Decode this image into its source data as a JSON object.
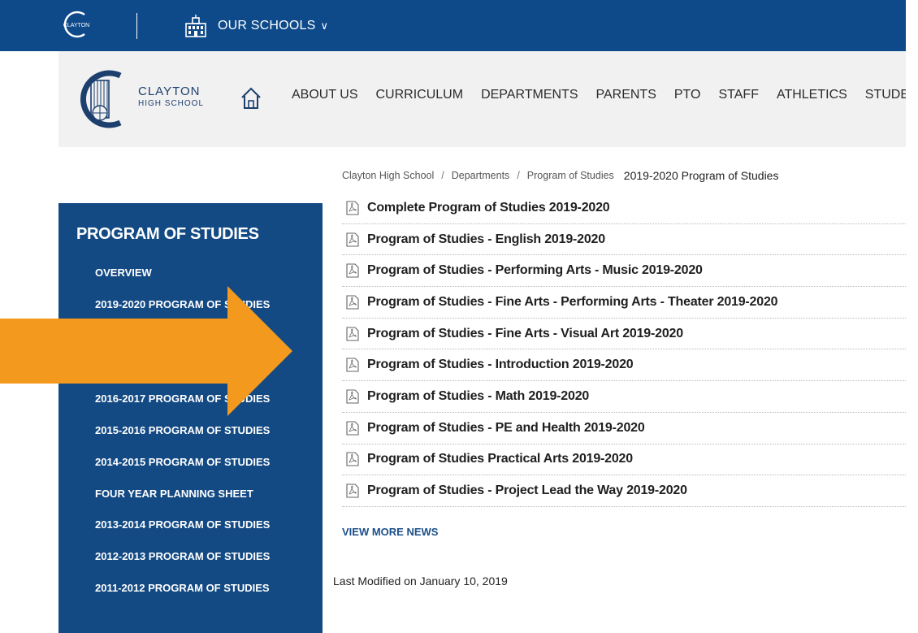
{
  "topbar": {
    "district_logo_text": "CLAYTON",
    "schools_label": "OUR SCHOOLS",
    "schools_chevron": "∨",
    "bg_color": "#0e4a8a"
  },
  "header": {
    "school_name_line1": "CLAYTON",
    "school_name_line2": "HIGH SCHOOL",
    "nav": [
      "ABOUT US",
      "CURRICULUM",
      "DEPARTMENTS",
      "PARENTS",
      "PTO",
      "STAFF",
      "ATHLETICS",
      "STUDENTS"
    ]
  },
  "sidebar": {
    "title": "PROGRAM OF STUDIES",
    "items": [
      "OVERVIEW",
      "2019-2020 PROGRAM OF STUDIES",
      "",
      "",
      "2016-2017 PROGRAM OF STUDIES",
      "2015-2016 PROGRAM OF STUDIES",
      "2014-2015 PROGRAM OF STUDIES",
      "FOUR YEAR PLANNING SHEET",
      "2013-2014 PROGRAM OF STUDIES",
      "2012-2013 PROGRAM OF STUDIES",
      "2011-2012 PROGRAM OF STUDIES"
    ],
    "bg_color": "#134a84"
  },
  "breadcrumb": {
    "items": [
      "Clayton High School",
      "Departments",
      "Program of Studies"
    ],
    "separator": "/",
    "current": "2019-2020 Program of Studies"
  },
  "documents": [
    "Complete Program of Studies 2019-2020",
    "Program of Studies - English 2019-2020",
    "Program of Studies - Performing Arts - Music 2019-2020",
    "Program of Studies - Fine Arts - Performing Arts - Theater 2019-2020",
    "Program of Studies - Fine Arts - Visual Art 2019-2020",
    "Program of Studies - Introduction 2019-2020",
    "Program of Studies - Math 2019-2020",
    "Program of Studies - PE and Health 2019-2020",
    "Program of Studies Practical Arts 2019-2020",
    "Program of Studies - Project Lead the Way 2019-2020"
  ],
  "view_more_label": "VIEW MORE NEWS",
  "last_modified": "Last Modified on January 10, 2019",
  "annotation_arrow_color": "#f39a1e"
}
